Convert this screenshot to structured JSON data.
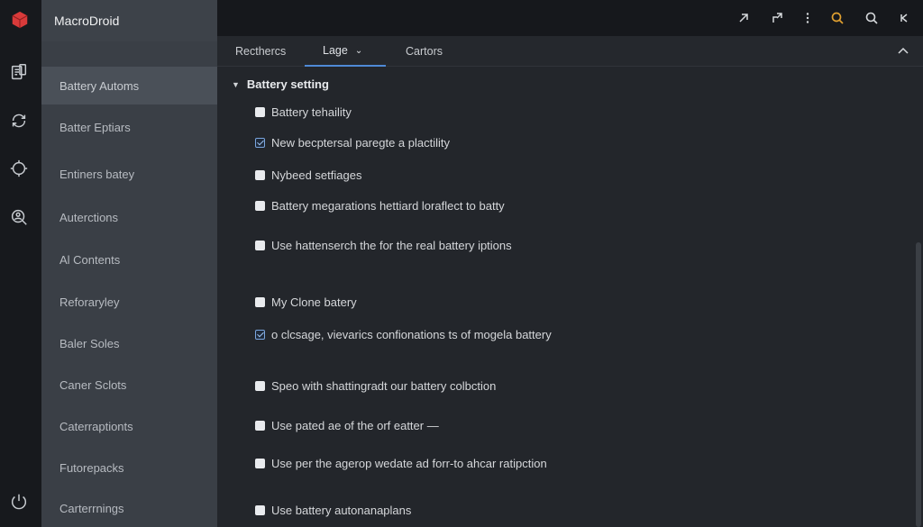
{
  "app": {
    "title": "MacroDroid"
  },
  "rail": {
    "icons": [
      "app-logo-icon",
      "devices-icon",
      "sync-icon",
      "refresh-icon",
      "search-user-icon",
      "power-icon"
    ]
  },
  "sidebar": {
    "items": [
      {
        "label": "Battery Automs",
        "active": true
      },
      {
        "label": "Batter Eptiars"
      },
      {
        "label": "Entiners batey"
      },
      {
        "label": "Auterctions"
      },
      {
        "label": "Al Contents"
      },
      {
        "label": "Reforaryley"
      },
      {
        "label": "Baler Soles"
      },
      {
        "label": "Caner Sclots"
      },
      {
        "label": "Caterraptionts"
      },
      {
        "label": "Futorepacks"
      },
      {
        "label": "Carterrnings"
      }
    ]
  },
  "topbar": {
    "icons": [
      "arrow-up-right-icon",
      "share-icon",
      "more-vertical-icon",
      "search-highlight-icon",
      "search-icon",
      "close-icon"
    ],
    "accent": "#e0a030"
  },
  "tabs": [
    {
      "label": "Recthercs"
    },
    {
      "label": "Lage",
      "active": true,
      "dropdown": true
    },
    {
      "label": "Cartors"
    }
  ],
  "main": {
    "section_title": "Battery setting",
    "options": [
      {
        "label": "Battery tehaility",
        "checked": false
      },
      {
        "label": "New becptersal paregte a plactility",
        "checked": true
      },
      {
        "label": "Nybeed setfiages",
        "checked": false
      },
      {
        "label": "Battery megarations hettiard loraflect to batty",
        "checked": false
      },
      {
        "label": "Use hattenserch the for the real battery iptions",
        "checked": false
      },
      {
        "label": "My Clone batery",
        "checked": false
      },
      {
        "label": "o clcsage, vievarics confionations ts of mogela battery",
        "checked": true
      },
      {
        "label": "Speo with shattingradt our battery colbction",
        "checked": false
      },
      {
        "label": "Use pated ae of the orf eatter —",
        "checked": false
      },
      {
        "label": "Use per the agerор wedate ad forr-to ahcar ratipction",
        "checked": false
      },
      {
        "label": "Use battery autonanaplans",
        "checked": false
      }
    ]
  },
  "colors": {
    "accent_blue": "#4f8ad6",
    "logo_red": "#d93a3a"
  }
}
